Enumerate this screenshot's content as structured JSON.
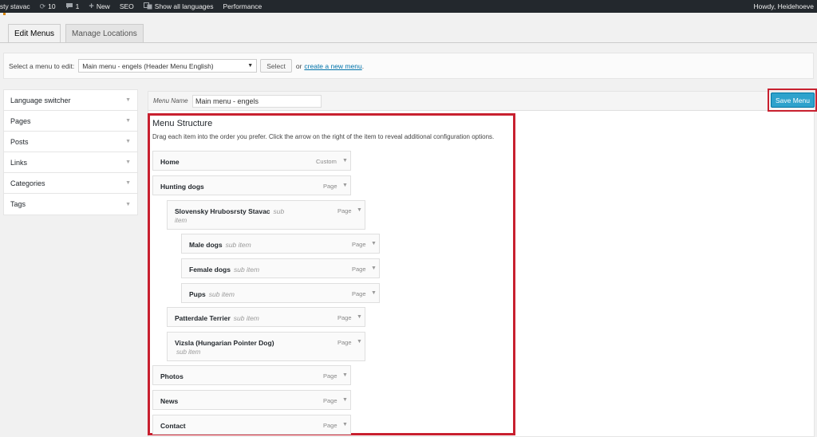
{
  "admin_bar": {
    "site": "rsty stavac",
    "updates_count": "10",
    "comments_count": "1",
    "new_label": "New",
    "seo_label": "SEO",
    "languages_label": "Show all languages",
    "performance_label": "Performance",
    "howdy": "Howdy, Heidehoeve"
  },
  "tabs": [
    {
      "label": "Edit Menus",
      "active": true
    },
    {
      "label": "Manage Locations",
      "active": false
    }
  ],
  "select_bar": {
    "label": "Select a menu to edit:",
    "selected": "Main menu - engels (Header Menu English)",
    "button": "Select",
    "or_text": "or",
    "create_link": "create a new menu",
    "period": "."
  },
  "sidebar": {
    "items": [
      {
        "label": "Language switcher"
      },
      {
        "label": "Pages"
      },
      {
        "label": "Posts"
      },
      {
        "label": "Links"
      },
      {
        "label": "Categories"
      },
      {
        "label": "Tags"
      }
    ]
  },
  "menu_header": {
    "name_label": "Menu Name",
    "name_value": "Main menu - engels",
    "save_button": "Save Menu"
  },
  "structure": {
    "title": "Menu Structure",
    "description": "Drag each item into the order you prefer. Click the arrow on the right of the item to reveal additional configuration options.",
    "items": [
      {
        "title": "Home",
        "sub": "",
        "sub2": "",
        "type": "Custom"
      },
      {
        "title": "Hunting dogs",
        "sub": "",
        "sub2": "",
        "type": "Page"
      },
      {
        "title": "Slovensky Hrubosrsty Stavac",
        "sub": "sub",
        "sub2": "item",
        "type": "Page"
      },
      {
        "title": "Male dogs",
        "sub": "sub item",
        "sub2": "",
        "type": "Page"
      },
      {
        "title": "Female dogs",
        "sub": "sub item",
        "sub2": "",
        "type": "Page"
      },
      {
        "title": "Pups",
        "sub": "sub item",
        "sub2": "",
        "type": "Page"
      },
      {
        "title": "Patterdale Terrier",
        "sub": "sub item",
        "sub2": "",
        "type": "Page"
      },
      {
        "title": "Vizsla (Hungarian Pointer Dog)",
        "sub": "",
        "sub2": "sub item",
        "type": "Page"
      },
      {
        "title": "Photos",
        "sub": "",
        "sub2": "",
        "type": "Page"
      },
      {
        "title": "News",
        "sub": "",
        "sub2": "",
        "type": "Page"
      },
      {
        "title": "Contact",
        "sub": "",
        "sub2": "",
        "type": "Page"
      }
    ]
  },
  "icons": {
    "updates": "refresh-icon",
    "comments": "comment-icon",
    "new": "plus-icon",
    "languages": "translate-icon",
    "dropdown": "triangle-down-icon"
  }
}
